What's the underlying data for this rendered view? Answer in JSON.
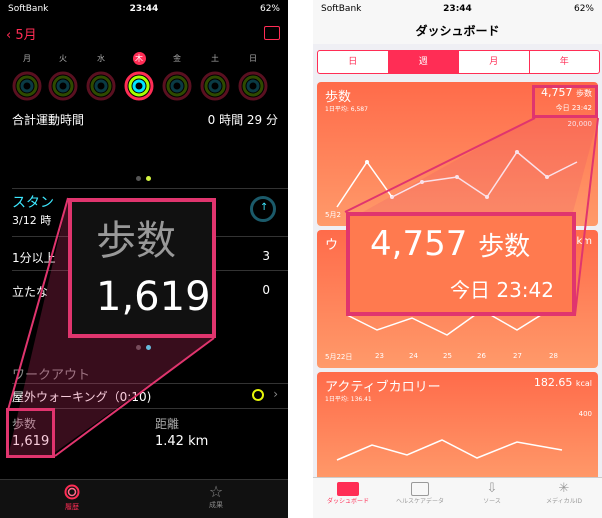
{
  "left": {
    "status": {
      "carrier": "SoftBank",
      "time": "23:44",
      "battery": "62%"
    },
    "nav": {
      "back": "5月"
    },
    "days": [
      {
        "label": "月",
        "today": false
      },
      {
        "label": "火",
        "today": false
      },
      {
        "label": "水",
        "today": false
      },
      {
        "label": "木",
        "today": true
      },
      {
        "label": "金",
        "today": false
      },
      {
        "label": "土",
        "today": false
      },
      {
        "label": "日",
        "today": false
      }
    ],
    "exercise": {
      "label": "合計運動時間",
      "value": "0 時間 29 分"
    },
    "stand": {
      "title": "スタン",
      "date": "3/12 時",
      "row1_label": "1分以上",
      "row1_value": "3",
      "row2_label": "立たな",
      "row2_value": "0"
    },
    "zoom": {
      "label": "歩数",
      "value": "1,619"
    },
    "workout": {
      "header": "ワークアウト",
      "item": "屋外ウォーキング（0:10)"
    },
    "stats": {
      "steps_label": "歩数",
      "steps_value": "1,619",
      "distance_label": "距離",
      "distance_value": "1.42 km"
    },
    "tabs": {
      "history": "履歴",
      "achievements": "成果"
    }
  },
  "right": {
    "status": {
      "carrier": "SoftBank",
      "time": "23:44",
      "battery": "62%"
    },
    "title": "ダッシュボード",
    "segments": [
      {
        "label": "日",
        "selected": false
      },
      {
        "label": "週",
        "selected": true
      },
      {
        "label": "月",
        "selected": false
      },
      {
        "label": "年",
        "selected": false
      }
    ],
    "steps_card": {
      "title": "歩数",
      "avg": "1日平均: 6,587",
      "value": "4,757",
      "unit": "歩数",
      "time": "今日 23:42",
      "ymax": "20,000",
      "xstart": "5月2"
    },
    "zoom": {
      "value": "4,757",
      "unit": "歩数",
      "time": "今日 23:42"
    },
    "distance_card": {
      "title": "ウ",
      "unit_partial": "km",
      "xlabels": [
        "5月22日",
        "23",
        "24",
        "25",
        "26",
        "27",
        "28"
      ]
    },
    "calorie_card": {
      "title": "アクティブカロリー",
      "avg": "1日平均: 136.41",
      "value": "182.65",
      "unit": "kcal",
      "ymax": "400"
    },
    "tabs": {
      "dashboard": "ダッシュボード",
      "healthdata": "ヘルスケアデータ",
      "sources": "ソース",
      "medicalid": "メディカルID"
    }
  }
}
